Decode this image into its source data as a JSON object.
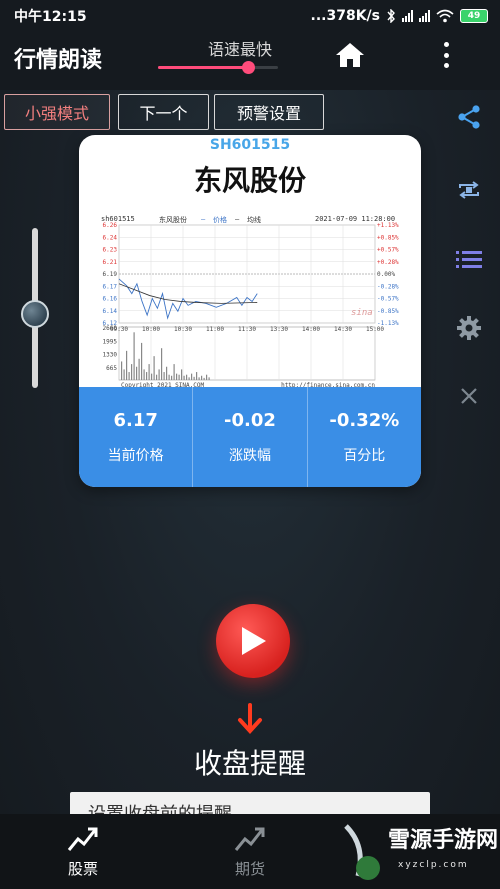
{
  "status_bar": {
    "time": "中午12:15",
    "network_speed": "...378K/s",
    "battery": "49"
  },
  "app_bar": {
    "title": "行情朗读",
    "speed_label": "语速最快",
    "speed_level": 0.75
  },
  "modes": {
    "small_strong": "小强模式",
    "next": "下一个",
    "alert_settings": "预警设置"
  },
  "toolbar": {
    "icons": [
      "share-icon",
      "repeat-one-icon",
      "list-icon",
      "settings-icon",
      "close-icon"
    ]
  },
  "volume": {
    "level": 0.5
  },
  "stock": {
    "code": "SH601515",
    "name": "东风股份",
    "price": "6.17",
    "price_label": "当前价格",
    "change": "-0.02",
    "change_label": "涨跌幅",
    "percent": "-0.32%",
    "percent_label": "百分比"
  },
  "chart": {
    "head_code": "sh601515",
    "head_name": "东风股份",
    "legend_price": "价格",
    "legend_avg": "均线",
    "datetime": "2021-07-09 11:28:00",
    "y_ticks": [
      "6.26",
      "6.24",
      "6.23",
      "6.21",
      "6.19",
      "6.17",
      "6.16",
      "6.14",
      "6.12"
    ],
    "pct_ticks": [
      "+1.13%",
      "+0.85%",
      "+0.57%",
      "+0.28%",
      "0.00%",
      "-0.28%",
      "-0.57%",
      "-0.85%",
      "-1.13%"
    ],
    "x_ticks": [
      "09:30",
      "10:00",
      "10:30",
      "11:00",
      "11:30",
      "13:30",
      "14:00",
      "14:30",
      "15:00"
    ],
    "vol_ticks": [
      "2660",
      "1995",
      "1330",
      "665"
    ],
    "copyright": "Copyright 2021 SINA.COM",
    "source_url": "http://finance.sina.com.cn",
    "logo": "sina"
  },
  "reminder": {
    "title": "收盘提醒",
    "input_text": "设置收盘前的提醒"
  },
  "bottom_nav": {
    "stocks": "股票",
    "futures": "期货"
  },
  "watermark": {
    "text": "雪源手游网",
    "url": "xyzclp.com"
  },
  "colors": {
    "accent_pink": "#ff4c7b",
    "stat_blue": "#3a8ee6",
    "play_red": "#e0302c"
  }
}
